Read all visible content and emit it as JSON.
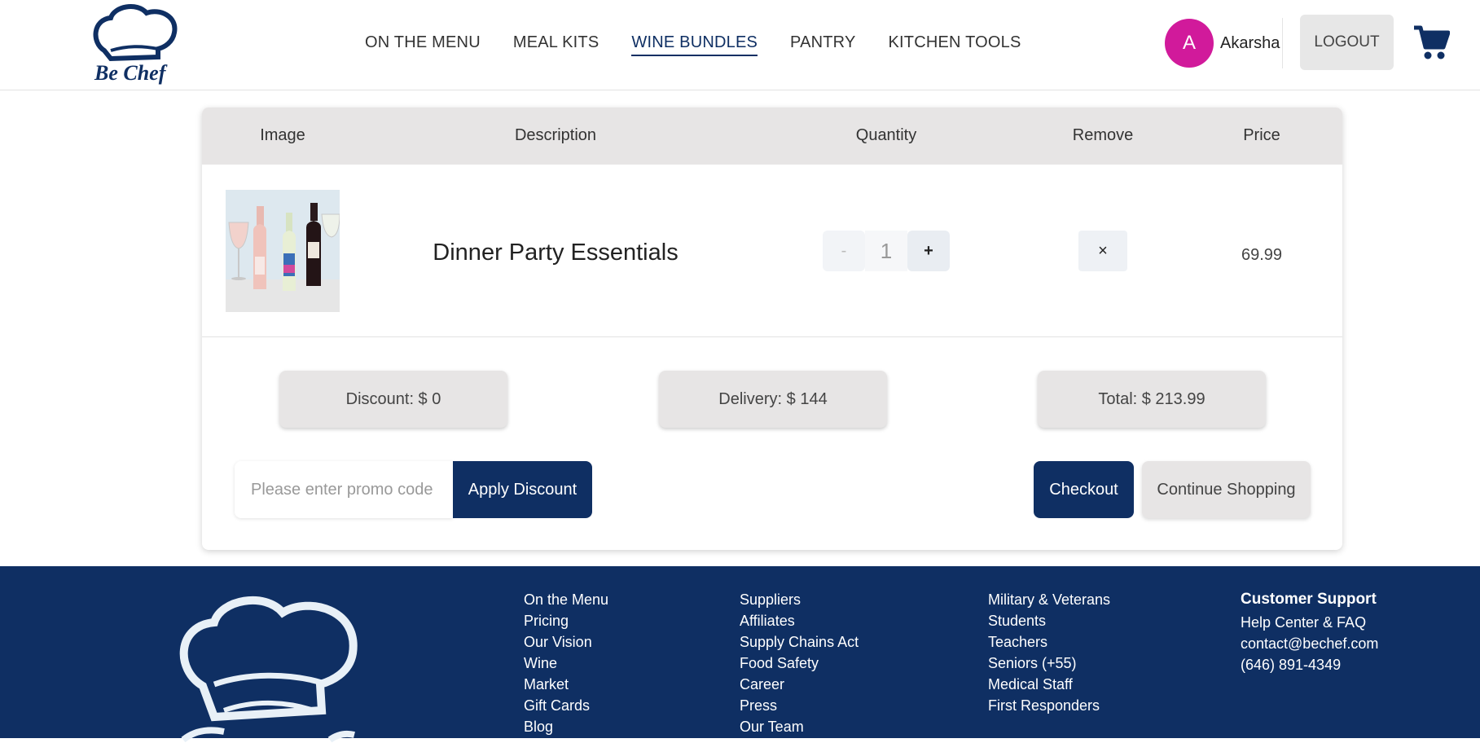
{
  "header": {
    "nav": [
      "ON THE MENU",
      "MEAL KITS",
      "WINE BUNDLES",
      "PANTRY",
      "KITCHEN TOOLS"
    ],
    "active_nav": "WINE BUNDLES",
    "user": {
      "initial": "A",
      "name": "Akarsha"
    },
    "logout_label": "LOGOUT",
    "avatar_color": "#d11a9b"
  },
  "cart": {
    "columns": {
      "image": "Image",
      "description": "Description",
      "quantity": "Quantity",
      "remove": "Remove",
      "price": "Price"
    },
    "items": [
      {
        "description": "Dinner Party Essentials",
        "quantity": "1",
        "decrement": "-",
        "increment": "+",
        "remove": "×",
        "price": "69.99"
      }
    ],
    "summary": {
      "discount": "Discount: $ 0",
      "delivery": "Delivery: $ 144",
      "total": "Total: $ 213.99"
    },
    "promo_placeholder": "Please enter promo code",
    "apply_label": "Apply Discount",
    "checkout_label": "Checkout",
    "continue_label": "Continue Shopping"
  },
  "footer": {
    "col1": [
      "On the Menu",
      "Pricing",
      "Our Vision",
      "Wine",
      "Market",
      "Gift Cards",
      "Blog"
    ],
    "col2": [
      "Suppliers",
      "Affiliates",
      "Supply Chains Act",
      "Food Safety",
      "Career",
      "Press",
      "Our Team"
    ],
    "col3": [
      "Military & Veterans",
      "Students",
      "Teachers",
      "Seniors (+55)",
      "Medical Staff",
      "First Responders"
    ],
    "support": {
      "heading": "Customer Support",
      "links": [
        "Help Center & FAQ",
        "contact@bechef.com",
        "(646) 891-4349"
      ]
    }
  },
  "colors": {
    "brand": "#0f2f63",
    "panel": "#e7e5e5"
  }
}
